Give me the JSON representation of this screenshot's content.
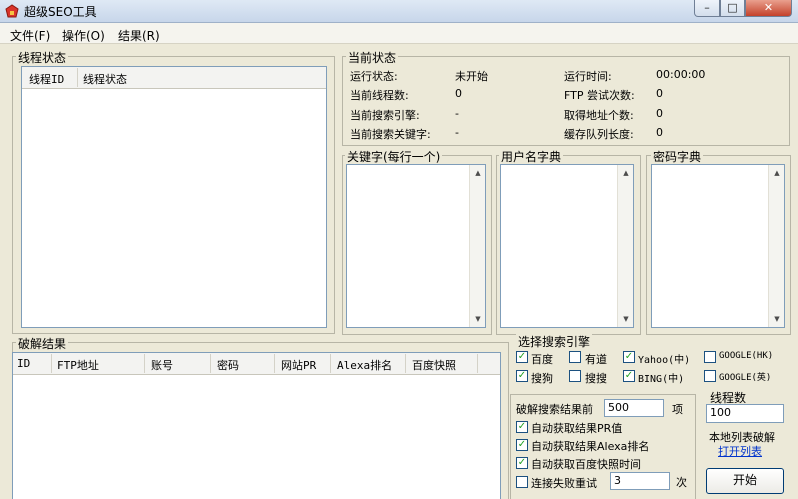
{
  "window": {
    "title": "超级SEO工具",
    "min": "–",
    "max": "□",
    "close": "✕"
  },
  "menu": [
    "文件(F)",
    "操作(O)",
    "结果(R)"
  ],
  "thread_panel": {
    "title": "线程状态",
    "columns": [
      "线程ID",
      "线程状态"
    ]
  },
  "status": {
    "title": "当前状态",
    "run_state_label": "运行状态:",
    "run_state_value": "未开始",
    "run_time_label": "运行时间:",
    "run_time_value": "00:00:00",
    "thread_count_label": "当前线程数:",
    "thread_count_value": "0",
    "ftp_tries_label": "FTP 尝试次数:",
    "ftp_tries_value": "0",
    "engine_label": "当前搜索引擎:",
    "engine_value": "-",
    "addr_count_label": "取得地址个数:",
    "addr_count_value": "0",
    "keyword_label": "当前搜索关键字:",
    "keyword_value": "-",
    "queue_label": "缓存队列长度:",
    "queue_value": "0"
  },
  "keywords": {
    "title": "关键字(每行一个)"
  },
  "usernames": {
    "title": "用户名字典"
  },
  "passwords": {
    "title": "密码字典"
  },
  "results": {
    "title": "破解结果",
    "columns": [
      "ID",
      "FTP地址",
      "账号",
      "密码",
      "网站PR",
      "Alexa排名",
      "百度快照"
    ]
  },
  "engines": {
    "title": "选择搜索引擎",
    "items": [
      {
        "label": "百度",
        "checked": true
      },
      {
        "label": "有道",
        "checked": false
      },
      {
        "label": "Yahoo(中)",
        "checked": true
      },
      {
        "label": "GOOGLE(HK)",
        "checked": false
      },
      {
        "label": "搜狗",
        "checked": true
      },
      {
        "label": "搜搜",
        "checked": false
      },
      {
        "label": "BING(中)",
        "checked": true
      },
      {
        "label": "GOOGLE(英)",
        "checked": false
      }
    ]
  },
  "options": {
    "top_results_label": "破解搜索结果前",
    "top_results_value": "500",
    "top_results_unit": "项",
    "checks": [
      {
        "label": "自动获取结果PR值",
        "checked": true
      },
      {
        "label": "自动获取结果Alexa排名",
        "checked": true
      },
      {
        "label": "自动获取百度快照时间",
        "checked": true
      },
      {
        "label": "连接失败重试",
        "checked": false
      }
    ],
    "retry_value": "3",
    "retry_unit": "次"
  },
  "threads": {
    "label": "线程数",
    "value": "100"
  },
  "local_list": {
    "label": "本地列表破解",
    "link": "打开列表"
  },
  "start_button": "开始",
  "colors": {
    "title_bar": "#c7d6ea",
    "face": "#ece9d8",
    "check": "#21a121",
    "link": "#0033cc"
  }
}
